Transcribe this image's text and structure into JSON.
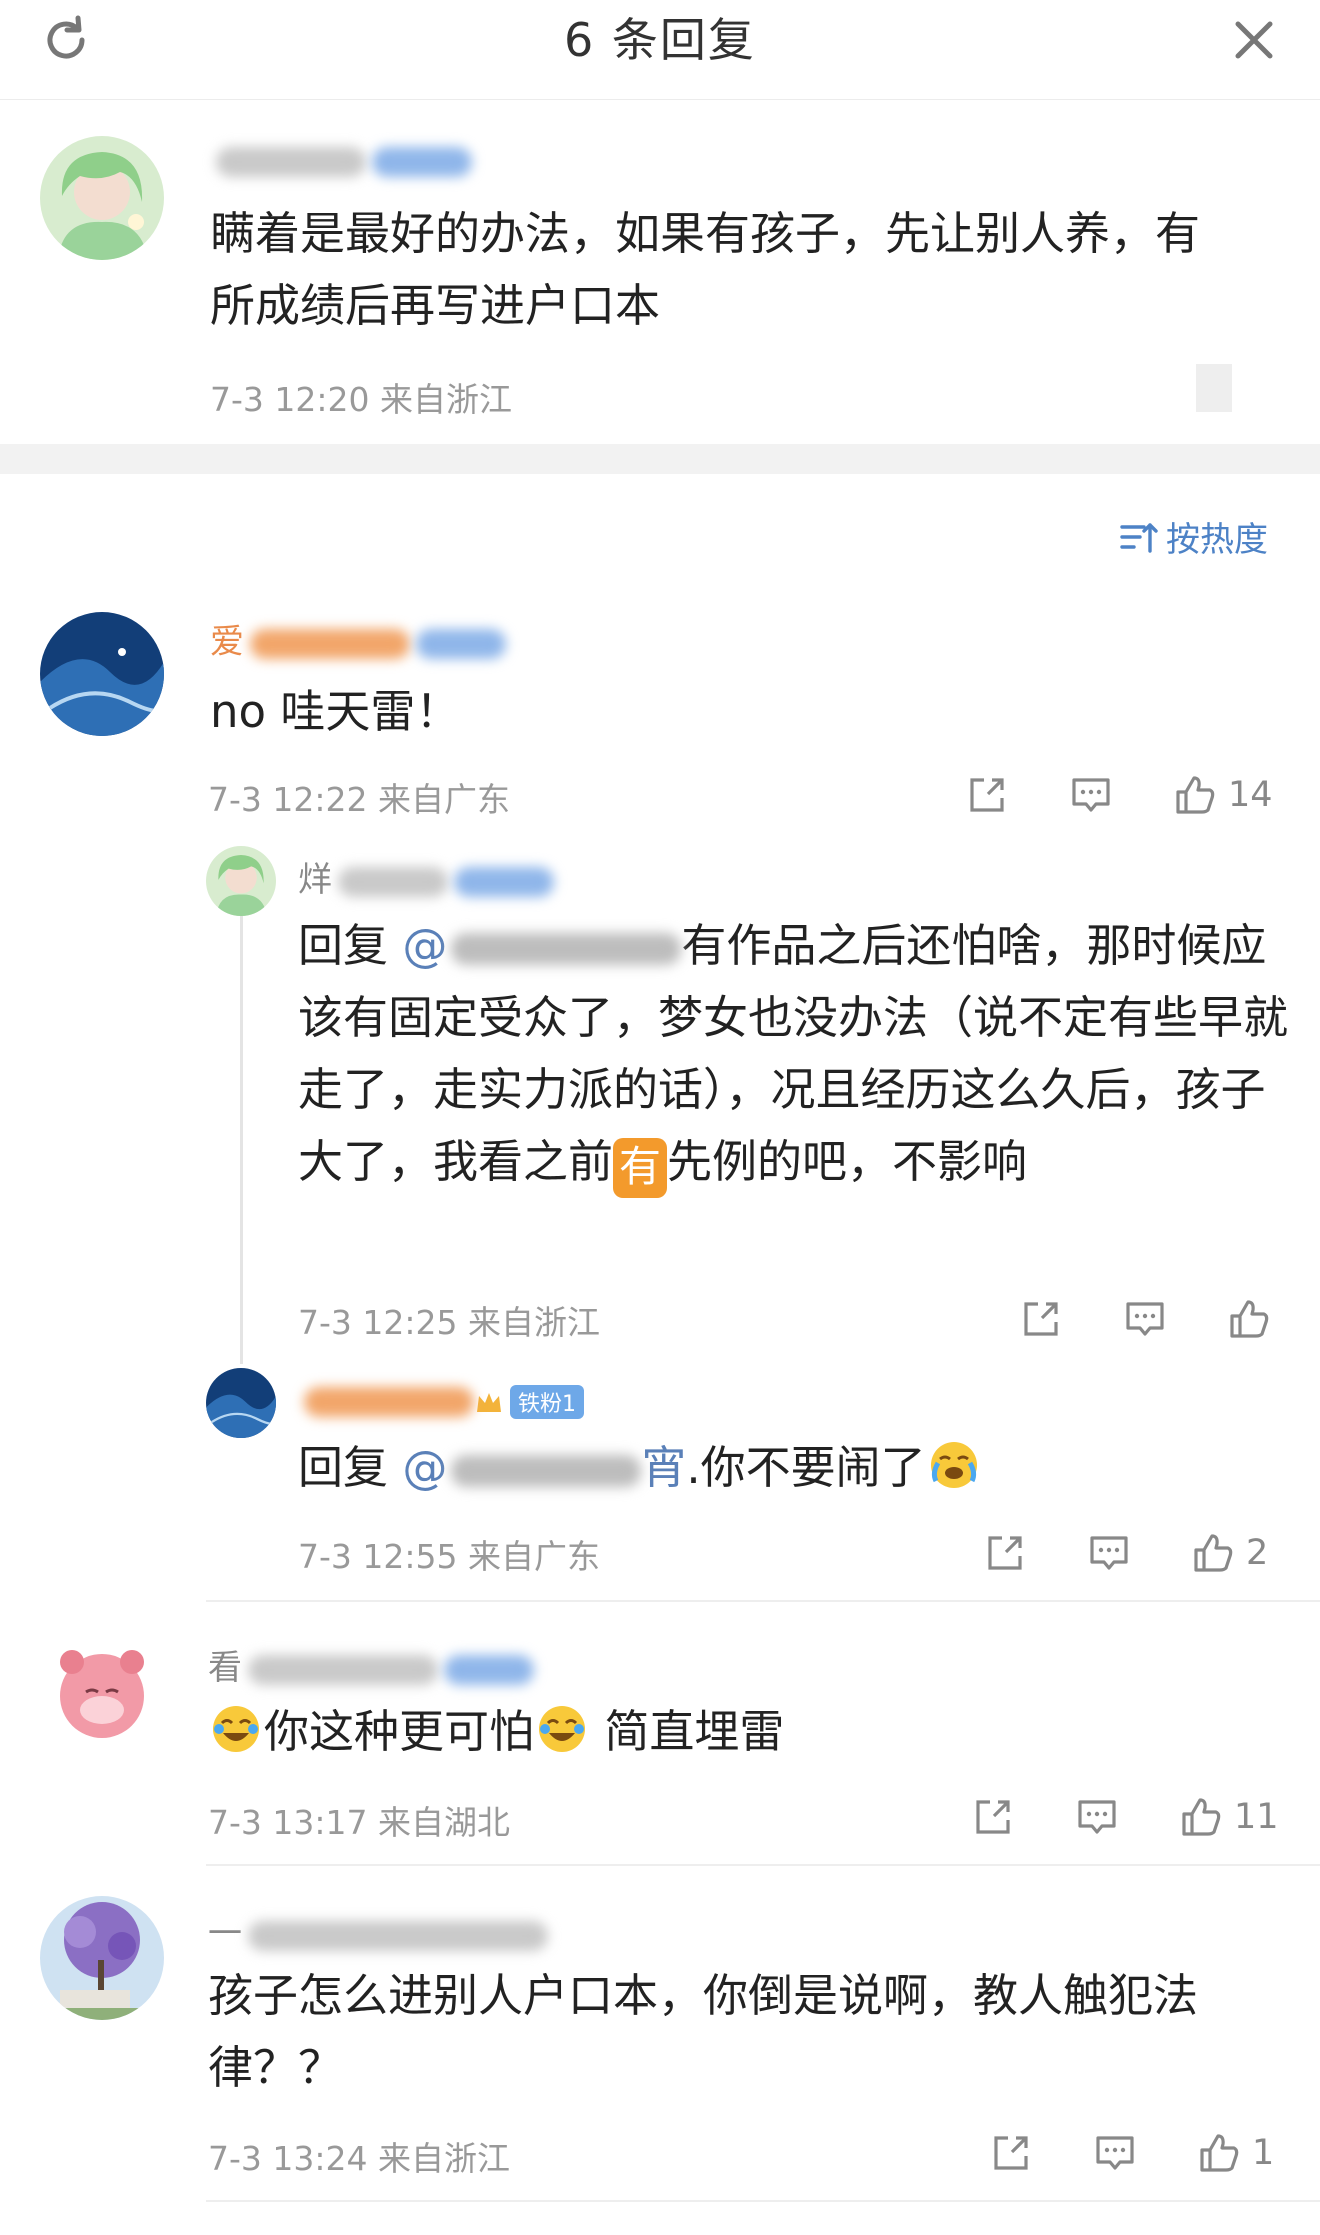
{
  "header": {
    "title": "6 条回复"
  },
  "original": {
    "name_visible": "",
    "text": "瞒着是最好的办法，如果有孩子，先让别人养，有所成绩后再写进户口本",
    "meta": "7-3 12:20 来自浙江"
  },
  "sort_label": "按热度",
  "comments": [
    {
      "name_visible": "爱",
      "text": "no  哇天雷！",
      "meta": "7-3 12:22 来自广东",
      "likes": "14",
      "replies": [
        {
          "name_visible": "烊",
          "text_before": "回复 ",
          "mention": "@",
          "text_after": "有作品之后还怕啥，那时候应该有固定受众了，梦女也没办法（说不定有些早就走了，走实力派的话），况且经历这么久后，孩子大了，我看之前",
          "badge": "有",
          "text_end": "先例的吧，不影响",
          "meta": "7-3 12:25 来自浙江",
          "likes": ""
        },
        {
          "name_visible": "",
          "fan_badge": "铁粉1",
          "text_before": "回复 ",
          "mention": "@",
          "mention_tail": "宵",
          "text_after": ".你不要闹了",
          "meta": "7-3 12:55 来自广东",
          "likes": "2"
        }
      ]
    },
    {
      "name_visible": "看",
      "text_mid": "你这种更可怕",
      "text_end": " 简直埋雷",
      "meta": "7-3 13:17 来自湖北",
      "likes": "11"
    },
    {
      "name_visible": "一",
      "text": "孩子怎么进别人户口本，你倒是说啊，教人触犯法律？？",
      "meta": "7-3 13:24 来自浙江",
      "likes": "1"
    }
  ],
  "icons": [
    "refresh-icon",
    "close-icon",
    "sort-icon",
    "share-icon",
    "comment-icon",
    "like-icon",
    "laugh-cry-emoji",
    "cry-emoji"
  ],
  "colors": {
    "link": "#5a80b8",
    "sort": "#4d82c6",
    "badge_orange": "#f39a2c",
    "meta_grey": "#999999"
  }
}
